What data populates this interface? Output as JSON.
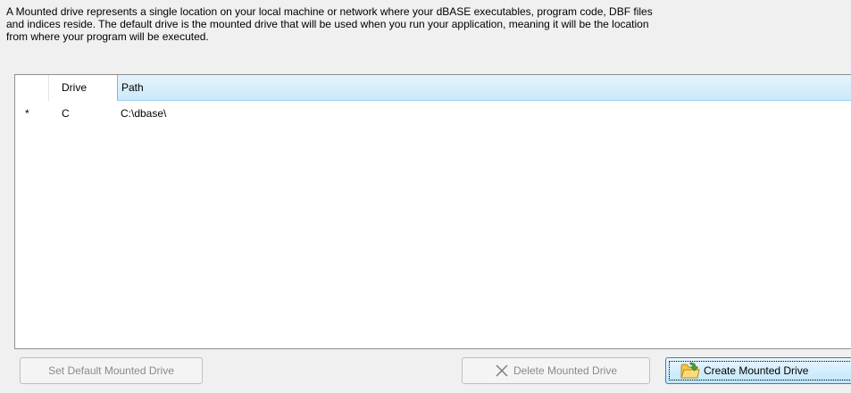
{
  "description": {
    "line1": "A Mounted drive represents a single location on your local machine or network where your dBASE executables, program code, DBF files",
    "line2": "and indices reside. The default drive is the mounted drive that will be used when you run your application, meaning it will be the location",
    "line3": "from where your program will be executed."
  },
  "grid": {
    "columns": {
      "drive": "Drive",
      "path": "Path"
    },
    "rows": [
      {
        "indicator": "*",
        "drive": "C",
        "path": "C:\\dbase\\"
      }
    ]
  },
  "buttons": {
    "set_default": "Set Default Mounted Drive",
    "delete": "Delete Mounted Drive",
    "create": "Create Mounted Drive"
  },
  "icons": {
    "delete": "x-icon",
    "create": "folder-add-icon"
  },
  "colors": {
    "header_selected": "#cbe9fa",
    "button_focus_border": "#3c7fb1",
    "disabled_text": "#8a8a8a"
  }
}
